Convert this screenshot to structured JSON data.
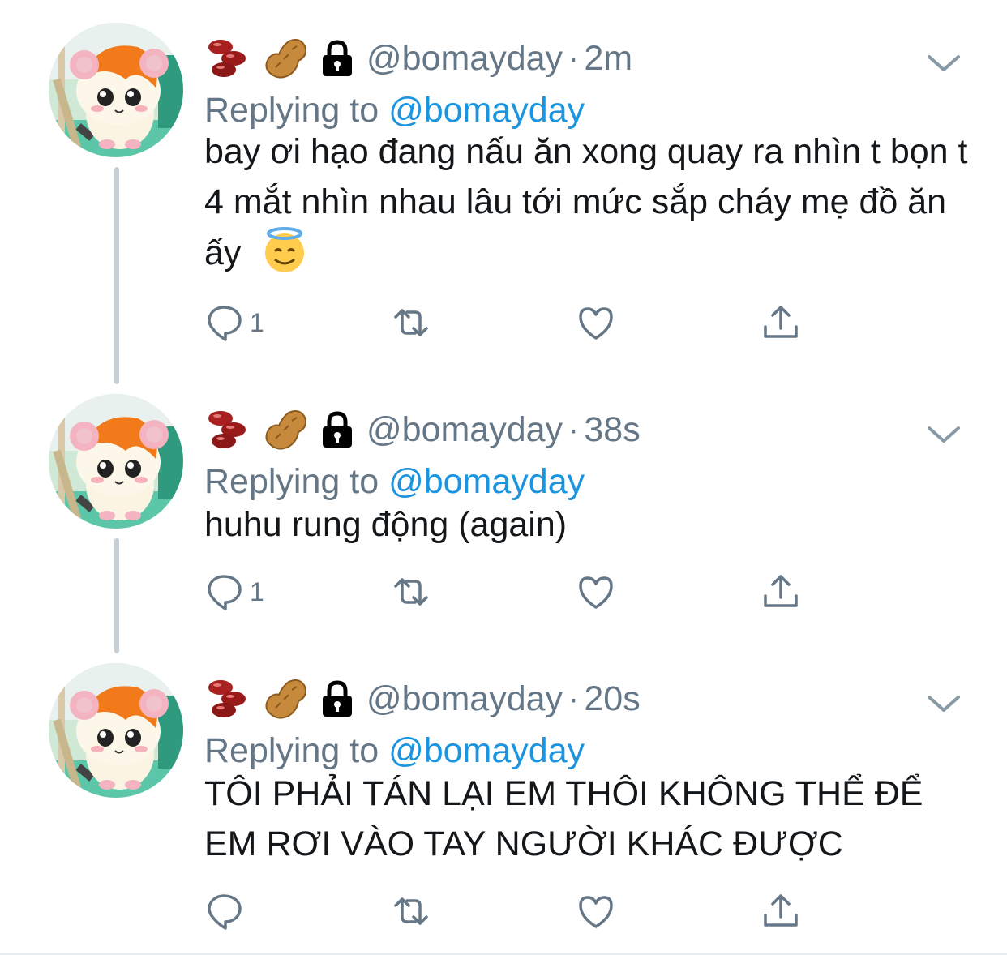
{
  "colors": {
    "secondary_text": "#657786",
    "link": "#1b95e0",
    "primary_text": "#14171a",
    "thread_line": "#c4cfd6"
  },
  "icons": {
    "display_name_emoji": [
      "beans-emoji",
      "peanut-emoji"
    ],
    "lock": "lock-icon",
    "menu": "chevron-down-icon",
    "actions": [
      "reply-icon",
      "retweet-icon",
      "like-icon",
      "share-icon"
    ]
  },
  "tweets": [
    {
      "handle": "@bomayday",
      "dot": "·",
      "time": "2m",
      "replying_prefix": "Replying to ",
      "replying_to": "@bomayday",
      "text": "bay ơi hạo đang nấu ăn xong quay ra nhìn t bọn t 4 mắt nhìn nhau lâu tới mức sắp cháy mẹ đồ ăn ấy",
      "text_emoji": "smiling-face-with-halo",
      "reply_count": "1"
    },
    {
      "handle": "@bomayday",
      "dot": "·",
      "time": "38s",
      "replying_prefix": "Replying to ",
      "replying_to": "@bomayday",
      "text": "huhu rung động (again)",
      "reply_count": "1"
    },
    {
      "handle": "@bomayday",
      "dot": "·",
      "time": "20s",
      "replying_prefix": "Replying to ",
      "replying_to": "@bomayday",
      "text": "TÔI PHẢI TÁN LẠI EM THÔI KHÔNG THỂ ĐỂ EM RƠI VÀO TAY NGƯỜI KHÁC ĐƯỢC",
      "reply_count": ""
    }
  ]
}
